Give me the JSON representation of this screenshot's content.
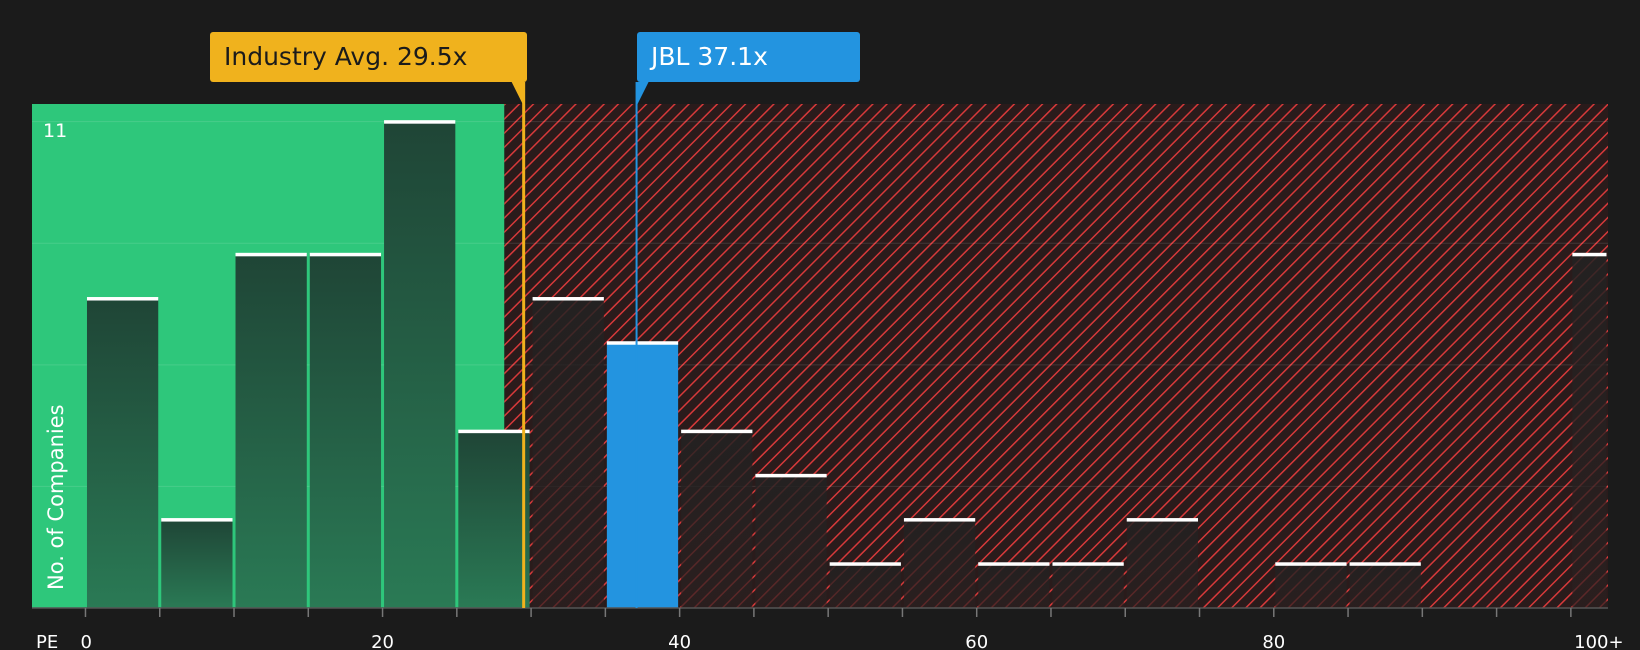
{
  "chart_data": {
    "type": "bar",
    "title": "",
    "xlabel": "PE",
    "ylabel": "No. of Companies",
    "ylim": [
      0,
      11.4
    ],
    "y_tick_labels": [
      {
        "value": 11,
        "label": "11"
      }
    ],
    "x_ticks": [
      {
        "value": 0,
        "label": "0"
      },
      {
        "value": 20,
        "label": "20"
      },
      {
        "value": 40,
        "label": "40"
      },
      {
        "value": 60,
        "label": "60"
      },
      {
        "value": 80,
        "label": "80"
      },
      {
        "value": 100,
        "label": "100+"
      }
    ],
    "bins": [
      {
        "from": 0,
        "to": 5,
        "count": 7
      },
      {
        "from": 5,
        "to": 10,
        "count": 2
      },
      {
        "from": 10,
        "to": 15,
        "count": 8
      },
      {
        "from": 15,
        "to": 20,
        "count": 8
      },
      {
        "from": 20,
        "to": 25,
        "count": 11
      },
      {
        "from": 25,
        "to": 30,
        "count": 4
      },
      {
        "from": 30,
        "to": 35,
        "count": 7
      },
      {
        "from": 35,
        "to": 40,
        "count": 6,
        "highlight": true
      },
      {
        "from": 40,
        "to": 45,
        "count": 4
      },
      {
        "from": 45,
        "to": 50,
        "count": 3
      },
      {
        "from": 50,
        "to": 55,
        "count": 1
      },
      {
        "from": 55,
        "to": 60,
        "count": 2
      },
      {
        "from": 60,
        "to": 65,
        "count": 1
      },
      {
        "from": 65,
        "to": 70,
        "count": 1
      },
      {
        "from": 70,
        "to": 75,
        "count": 2
      },
      {
        "from": 75,
        "to": 80,
        "count": 0
      },
      {
        "from": 80,
        "to": 85,
        "count": 1
      },
      {
        "from": 85,
        "to": 90,
        "count": 1
      },
      {
        "from": 90,
        "to": 95,
        "count": 0
      },
      {
        "from": 95,
        "to": 100,
        "count": 0
      },
      {
        "from": 100,
        "to": 102.5,
        "count": 8
      }
    ],
    "x_range": [
      -3.6,
      102.5
    ],
    "fair_zone_end": 28.2,
    "markers": [
      {
        "name": "industry-avg",
        "label": "Industry Avg. 29.5x",
        "value": 29.5,
        "color": "#f0b21d",
        "text_color": "#1b1b1b"
      },
      {
        "name": "jbl",
        "label": "JBL 37.1x",
        "value": 37.1,
        "color": "#2394e0",
        "text_color": "#ffffff"
      }
    ],
    "colors": {
      "background": "#1b1b1b",
      "fair_zone": "#2ec77b",
      "over_zone": "#2a1b1b",
      "hatch": "#d6393a",
      "bar_dark": "#1f4a38",
      "bar_dark_bottom": "#2a7a55",
      "highlight_bar": "#2394e0",
      "grid": "#ffffff"
    }
  }
}
